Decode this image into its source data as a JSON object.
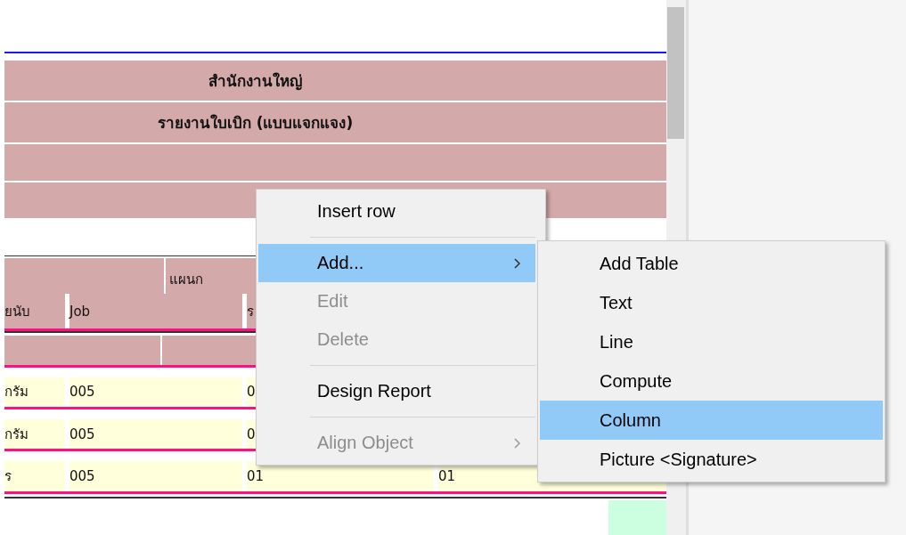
{
  "report": {
    "title_rows": [
      "สำนักงานใหญ่",
      "รายงานใบเบิก (แบบแจกแจง)",
      "",
      ""
    ]
  },
  "table": {
    "group_header": "แผนก",
    "columns": [
      "ยนับ",
      "Job",
      "ร",
      ""
    ],
    "rows": [
      {
        "cells": [
          "กรัม",
          "005",
          "0",
          ""
        ]
      },
      {
        "cells": [
          "กรัม",
          "005",
          "0",
          ""
        ]
      },
      {
        "cells": [
          "ร",
          "005",
          "01",
          "01"
        ]
      }
    ]
  },
  "context_menu": {
    "items": [
      {
        "label": "Insert row",
        "disabled": false,
        "selected": false,
        "submenu": false,
        "separator_before": false
      },
      {
        "label": "Add...",
        "disabled": false,
        "selected": true,
        "submenu": true,
        "separator_before": true
      },
      {
        "label": "Edit",
        "disabled": true,
        "selected": false,
        "submenu": false,
        "separator_before": false
      },
      {
        "label": "Delete",
        "disabled": true,
        "selected": false,
        "submenu": false,
        "separator_before": false
      },
      {
        "label": "Design Report",
        "disabled": false,
        "selected": false,
        "submenu": false,
        "separator_before": true
      },
      {
        "label": "Align Object",
        "disabled": true,
        "selected": false,
        "submenu": true,
        "separator_before": true
      }
    ]
  },
  "submenu": {
    "items": [
      {
        "label": "Add Table",
        "selected": false
      },
      {
        "label": "Text",
        "selected": false
      },
      {
        "label": "Line",
        "selected": false
      },
      {
        "label": "Compute",
        "selected": false
      },
      {
        "label": "Column",
        "selected": true
      },
      {
        "label": "Picture <Signature>",
        "selected": false
      }
    ]
  }
}
